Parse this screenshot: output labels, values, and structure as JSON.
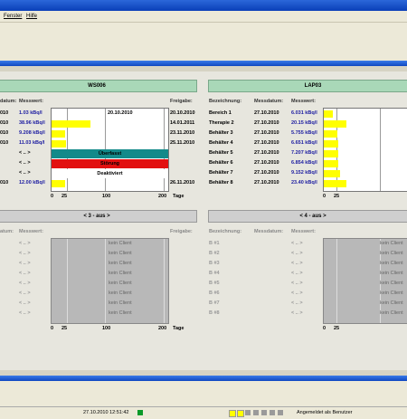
{
  "menu": {
    "items": [
      "Fenster",
      "Hilfe"
    ]
  },
  "panels": {
    "ws006": {
      "title": "WS006",
      "headers": {
        "bezeichnung": "datum:",
        "messwert": "Messwert:",
        "freigabe": "Freigabe:"
      },
      "rows": [
        {
          "datum": "010",
          "messwert": "1.03 kBq/l",
          "date_in_chart": "20.10.2010",
          "freigabe": "20.10.2010",
          "bar_value": 0
        },
        {
          "datum": "010",
          "messwert": "38.96 kBq/l",
          "date_in_chart": "",
          "freigabe": "14.01.2011",
          "bar_value": 85
        },
        {
          "datum": "010",
          "messwert": "9.208 kBq/l",
          "date_in_chart": "",
          "freigabe": "23.11.2010",
          "bar_value": 30
        },
        {
          "datum": "010",
          "messwert": "11.03 kBq/l",
          "date_in_chart": "",
          "freigabe": "25.11.2010",
          "bar_value": 32
        },
        {
          "datum": "",
          "messwert": "< .. >",
          "status": "Überfasst",
          "status_color": "#138a8a"
        },
        {
          "datum": "",
          "messwert": "< .. >",
          "status": "Störung",
          "status_color": "#e21010"
        },
        {
          "datum": "",
          "messwert": "< .. >",
          "status": "Deaktiviert",
          "status_color": "#ffffff"
        },
        {
          "datum": "010",
          "messwert": "12.00 kBq/l",
          "date_in_chart": "",
          "freigabe": "26.11.2010",
          "bar_value": 30
        }
      ],
      "axis": {
        "ticks": [
          "0",
          "25",
          "100",
          "200"
        ],
        "unit": "Tage"
      }
    },
    "lap03": {
      "title": "LAP03",
      "headers": {
        "bezeichnung": "Bezeichnung:",
        "datum": "Messdatum:",
        "messwert": "Messwert:"
      },
      "rows": [
        {
          "name": "Bereich 1",
          "datum": "27.10.2010",
          "messwert": "6.031 kBq/l",
          "bar_value": 10
        },
        {
          "name": "Therapie 2",
          "datum": "27.10.2010",
          "messwert": "20.15 kBq/l",
          "bar_value": 25
        },
        {
          "name": "Behälter 3",
          "datum": "27.10.2010",
          "messwert": "5.755 kBq/l",
          "bar_value": 15
        },
        {
          "name": "Behälter 4",
          "datum": "27.10.2010",
          "messwert": "6.651 kBq/l",
          "bar_value": 16
        },
        {
          "name": "Behälter 5",
          "datum": "27.10.2010",
          "messwert": "7.207 kBq/l",
          "bar_value": 16
        },
        {
          "name": "Behälter 6",
          "datum": "27.10.2010",
          "messwert": "6.854 kBq/l",
          "bar_value": 16
        },
        {
          "name": "Behälter 7",
          "datum": "27.10.2010",
          "messwert": "9.152 kBq/l",
          "bar_value": 18
        },
        {
          "name": "Behälter 8",
          "datum": "27.10.2010",
          "messwert": "23.40 kBq/l",
          "bar_value": 25
        }
      ],
      "axis": {
        "ticks": [
          "0",
          "25"
        ]
      }
    },
    "p3": {
      "title": "< 3 - aus >",
      "headers": {
        "bezeichnung": "atum:",
        "messwert": "Messwert:",
        "freigabe": "Freigabe:"
      },
      "rows": [
        "< .. >",
        "< .. >",
        "< .. >",
        "< .. >",
        "< .. >",
        "< .. >",
        "< .. >",
        "< .. >"
      ],
      "client": "kein Client",
      "axis": {
        "ticks": [
          "0",
          "25",
          "100",
          "200"
        ],
        "unit": "Tage"
      }
    },
    "p4": {
      "title": "< 4 - aus >",
      "headers": {
        "bezeichnung": "Bezeichnung:",
        "datum": "Messdatum:",
        "messwert": "Messwert:"
      },
      "rows": [
        {
          "name": "B #1",
          "messwert": "< .. >"
        },
        {
          "name": "B #2",
          "messwert": "< .. >"
        },
        {
          "name": "B #3",
          "messwert": "< .. >"
        },
        {
          "name": "B #4",
          "messwert": "< .. >"
        },
        {
          "name": "B #5",
          "messwert": "< .. >"
        },
        {
          "name": "B #6",
          "messwert": "< .. >"
        },
        {
          "name": "B #7",
          "messwert": "< .. >"
        },
        {
          "name": "B #8",
          "messwert": "< .. >"
        }
      ],
      "client": "kein Client",
      "axis": {
        "ticks": [
          "0",
          "25"
        ]
      }
    }
  },
  "statusbar": {
    "datetime": "27.10.2010 12:51:42",
    "user": "Angemeldet als Benutzer"
  }
}
